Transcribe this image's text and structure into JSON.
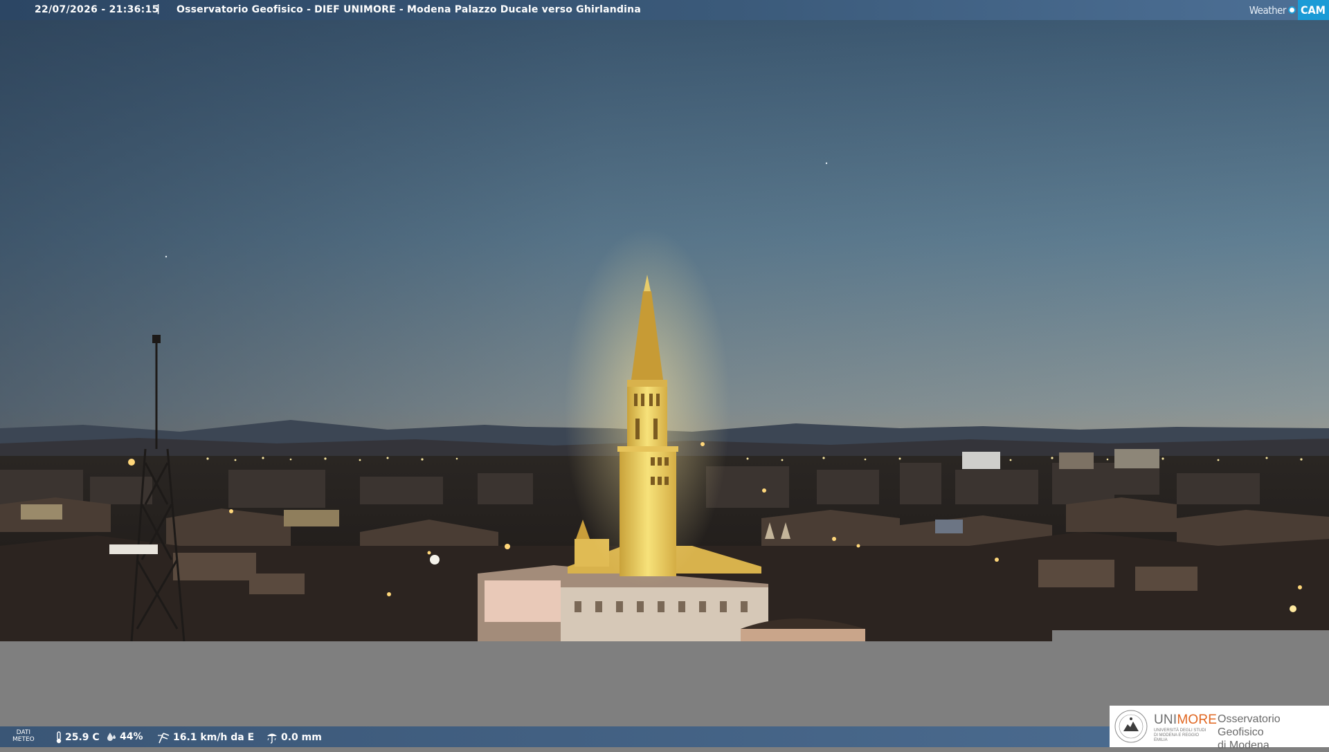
{
  "header": {
    "timestamp": "22/07/2026 - 21:36:15",
    "separator": "|",
    "title": "Osservatorio Geofisico - DIEF UNIMORE - Modena Palazzo Ducale verso Ghirlandina",
    "brand_weather": "Weather",
    "brand_cam": "CAM"
  },
  "meteo": {
    "label_line1": "DATI",
    "label_line2": "METEO",
    "temperature": "25.9 C",
    "humidity": "44%",
    "wind": "16.1 km/h da E",
    "rain": "0.0 mm",
    "icons": [
      "thermometer-icon",
      "humidity-drop-icon",
      "wind-icon",
      "rain-gauge-icon"
    ]
  },
  "logo": {
    "uni_part1": "UNI",
    "uni_part2": "MORE",
    "uni_sub": "UNIVERSITÀ DEGLI STUDI DI MODENA E REGGIO EMILIA",
    "obs_line1": "Osservatorio Geofisico",
    "obs_line2": "di Modena"
  },
  "colors": {
    "sky_top": "#3c5a72",
    "sky_horizon": "#c9a070",
    "tower_light": "#f2d560",
    "brand_blue": "#1b9bd6",
    "unimore_orange": "#e0651f"
  }
}
